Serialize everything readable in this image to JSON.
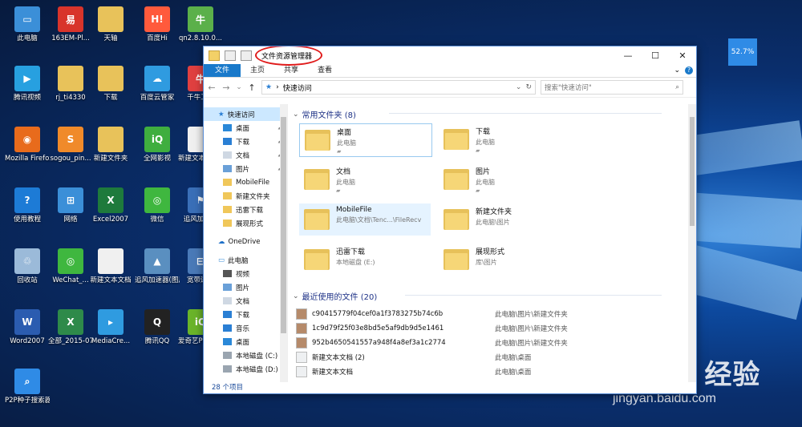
{
  "desktop": {
    "icons": [
      {
        "label": "此电脑",
        "color": "#3b8fd8",
        "glyph": "▭"
      },
      {
        "label": "163EM-Pl...",
        "color": "#d8342b",
        "glyph": "易"
      },
      {
        "label": "天轴",
        "color": "#e8c25a",
        "glyph": ""
      },
      {
        "label": "百度Hi",
        "color": "#ff5a3c",
        "glyph": "H!"
      },
      {
        "label": "qn2.8.10.0...",
        "color": "#5bb04a",
        "glyph": "牛"
      },
      {
        "label": "腾讯视频",
        "color": "#27a0e0",
        "glyph": "▶"
      },
      {
        "label": "rj_ti4330",
        "color": "#e8c25a",
        "glyph": ""
      },
      {
        "label": "下载",
        "color": "#e8c25a",
        "glyph": ""
      },
      {
        "label": "百度云管家",
        "color": "#2f9be0",
        "glyph": "☁"
      },
      {
        "label": "千牛工...",
        "color": "#e04040",
        "glyph": "牛"
      },
      {
        "label": "Mozilla Firefox",
        "color": "#e86b1c",
        "glyph": "◉"
      },
      {
        "label": "sogou_pin...",
        "color": "#f08a2a",
        "glyph": "S"
      },
      {
        "label": "新建文件夹",
        "color": "#e8c25a",
        "glyph": ""
      },
      {
        "label": "全网影视",
        "color": "#3fae3f",
        "glyph": "iQ"
      },
      {
        "label": "新建文本文档 (2)",
        "color": "#f0f0f0",
        "glyph": ""
      },
      {
        "label": "使用教程",
        "color": "#1d7bd6",
        "glyph": "?"
      },
      {
        "label": "网络",
        "color": "#3b8fd8",
        "glyph": "⊞"
      },
      {
        "label": "Excel2007",
        "color": "#1e7a3c",
        "glyph": "X"
      },
      {
        "label": "微信",
        "color": "#3fb73f",
        "glyph": "◎"
      },
      {
        "label": "追风加速器",
        "color": "#3a6fb8",
        "glyph": "⚑"
      },
      {
        "label": "回收站",
        "color": "#9bbad9",
        "glyph": "♲"
      },
      {
        "label": "WeChat_...",
        "color": "#3fb73f",
        "glyph": "◎"
      },
      {
        "label": "新建文本文档",
        "color": "#f0f0f0",
        "glyph": ""
      },
      {
        "label": "追风加速器(图片说明)",
        "color": "#5a8fc0",
        "glyph": "▲"
      },
      {
        "label": "宽带连接",
        "color": "#4a7ab8",
        "glyph": "⊟"
      },
      {
        "label": "Word2007",
        "color": "#2b5cb0",
        "glyph": "W"
      },
      {
        "label": "全部_2015-07...",
        "color": "#2e8a4a",
        "glyph": "X"
      },
      {
        "label": "MediaCre...",
        "color": "#2f9be0",
        "glyph": "▸"
      },
      {
        "label": "腾讯QQ",
        "color": "#222",
        "glyph": "Q"
      },
      {
        "label": "爱奇艺PPS影音",
        "color": "#6ab42a",
        "glyph": "iQ"
      },
      {
        "label": "P2P种子搜索器",
        "color": "#2f8be6",
        "glyph": "⌕"
      }
    ],
    "badge": "52.7%",
    "watermark_big": "Bai du 经验",
    "watermark_small": "jingyan.baidu.com"
  },
  "window": {
    "title": "文件资源管理器",
    "controls": {
      "minimize": "—",
      "maximize": "☐",
      "close": "✕"
    },
    "ribbon_tabs": [
      "文件",
      "主页",
      "共享",
      "查看"
    ],
    "ribbon_collapse": "⌄",
    "help": "?",
    "nav_back": "←",
    "nav_forward": "→",
    "nav_dropdown": "⌄",
    "nav_up": "↑",
    "address_path": "快速访问",
    "address_sep": "›",
    "address_refresh": "↻",
    "search_placeholder": "搜索\"快速访问\"",
    "sidebar": {
      "quick_access": "快速访问",
      "items": [
        {
          "label": "桌面",
          "icon": "desktop-icon",
          "pinned": true
        },
        {
          "label": "下载",
          "icon": "download-icon",
          "pinned": true
        },
        {
          "label": "文档",
          "icon": "document-icon",
          "pinned": true
        },
        {
          "label": "图片",
          "icon": "pictures-icon",
          "pinned": true
        },
        {
          "label": "MobileFile",
          "icon": "folder-icon",
          "pinned": false
        },
        {
          "label": "新建文件夹",
          "icon": "folder-icon",
          "pinned": false
        },
        {
          "label": "迅雷下载",
          "icon": "folder-icon",
          "pinned": false
        },
        {
          "label": "展现形式",
          "icon": "folder-icon",
          "pinned": false
        }
      ],
      "onedrive": "OneDrive",
      "this_pc": "此电脑",
      "pc_items": [
        {
          "label": "视频",
          "icon": "video-icon"
        },
        {
          "label": "图片",
          "icon": "pictures-icon"
        },
        {
          "label": "文档",
          "icon": "document-icon"
        },
        {
          "label": "下载",
          "icon": "download-icon"
        },
        {
          "label": "音乐",
          "icon": "music-icon"
        },
        {
          "label": "桌面",
          "icon": "desktop-icon"
        },
        {
          "label": "本地磁盘 (C:)",
          "icon": "drive-icon"
        },
        {
          "label": "本地磁盘 (D:)",
          "icon": "drive-icon"
        }
      ]
    },
    "frequent_header": "常用文件夹 (8)",
    "folders": [
      {
        "name": "桌面",
        "loc": "此电脑",
        "pin": "📌"
      },
      {
        "name": "下载",
        "loc": "此电脑",
        "pin": "📌"
      },
      {
        "name": "文档",
        "loc": "此电脑",
        "pin": "📌"
      },
      {
        "name": "图片",
        "loc": "此电脑",
        "pin": "📌"
      },
      {
        "name": "MobileFile",
        "loc": "此电脑\\文档\\Tenc...\\FileRecv",
        "pin": ""
      },
      {
        "name": "新建文件夹",
        "loc": "此电脑\\图片",
        "pin": ""
      },
      {
        "name": "迅雷下载",
        "loc": "本地磁盘 (E:)",
        "pin": ""
      },
      {
        "name": "展现形式",
        "loc": "库\\图片",
        "pin": ""
      }
    ],
    "recent_header": "最近使用的文件 (20)",
    "recent": [
      {
        "name": "c90415779f04cef0a1f3783275b74c6b",
        "loc": "此电脑\\图片\\新建文件夹"
      },
      {
        "name": "1c9d79f25f03e8bd5e5af9db9d5e1461",
        "loc": "此电脑\\图片\\新建文件夹"
      },
      {
        "name": "952b4650541557a948f4a8ef3a1c2774",
        "loc": "此电脑\\图片\\新建文件夹"
      },
      {
        "name": "新建文本文档 (2)",
        "loc": "此电脑\\桌面"
      },
      {
        "name": "新建文本文档",
        "loc": "此电脑\\桌面"
      }
    ],
    "status": "28 个项目"
  }
}
